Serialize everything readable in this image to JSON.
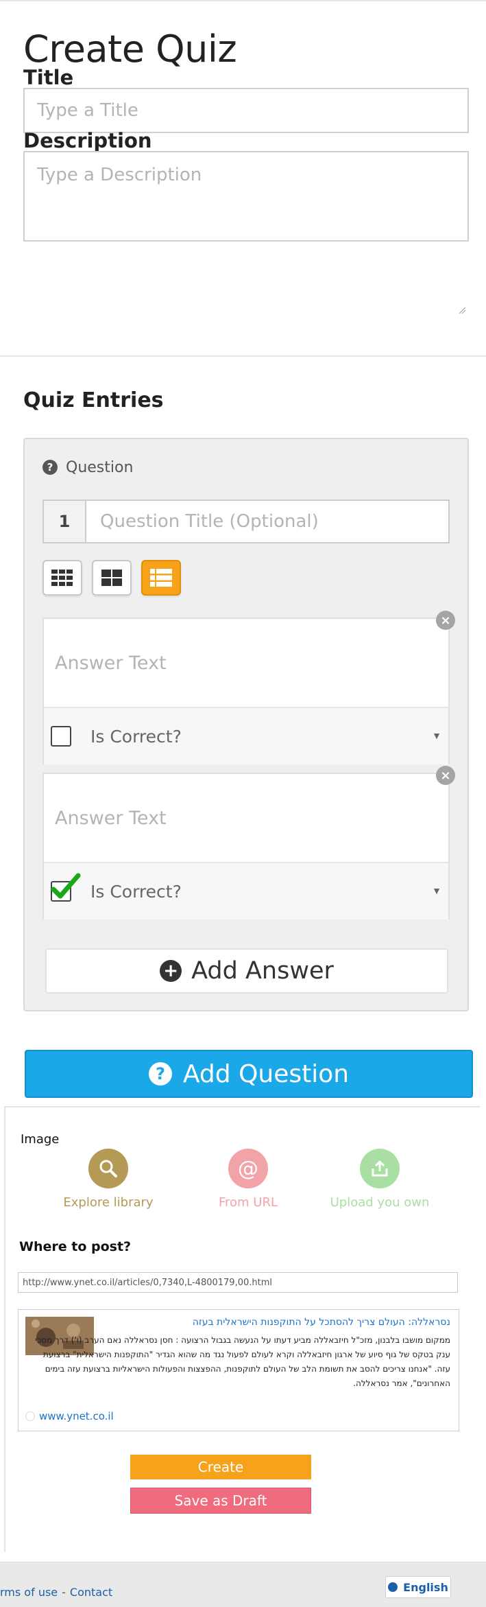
{
  "header": {
    "title": "Create Quiz"
  },
  "form": {
    "title_label": "Title",
    "title_placeholder": "Type a Title",
    "description_label": "Description",
    "description_placeholder": "Type a Description"
  },
  "entries": {
    "section_title": "Quiz Entries",
    "question_label": "Question",
    "question_number": "1",
    "question_placeholder": "Question Title (Optional)",
    "layout_options": [
      "grid-3x3-icon",
      "grid-2x2-icon",
      "list-icon"
    ],
    "active_layout": "list-icon",
    "answers": [
      {
        "placeholder": "Answer Text",
        "correct_label": "Is Correct?",
        "checked": false
      },
      {
        "placeholder": "Answer Text",
        "correct_label": "Is Correct?",
        "checked": true
      }
    ],
    "add_answer_label": "Add Answer",
    "add_question_label": "Add Question"
  },
  "image": {
    "label": "Image",
    "options": [
      {
        "label": "Explore library",
        "icon": "search-icon",
        "color": "#b59a55"
      },
      {
        "label": "From URL",
        "icon": "at-sign-icon",
        "color": "#f2a3a8"
      },
      {
        "label": "Upload you own",
        "icon": "upload-icon",
        "color": "#a9dfa2"
      }
    ]
  },
  "post": {
    "label": "Where to post?",
    "url": "http://www.ynet.co.il/articles/0,7340,L-4800179,00.html",
    "preview": {
      "title": "נסראללה: העולם צריך להסתכל על התוקפנות הישראלית בעזה",
      "body": "ממקום מושבו בלבנון, מזכ\"ל חיזבאללה מביע דעתו על הנעשה בגבול הרצועה : חסן נסראללה נאם הערב (ו') דרך מסכי ענק בטקס של גוף סיוע של ארגון חיזבאללה וקרא לעולם לפעול נגד מה שהוא הגדיר \"התוקפנות הישראלית\" ברצועת עזה. \"אנחנו צריכים להסב את תשומת הלב של העולם לתוקפנות, ההפצצות והפעולות הישראליות ברצועת עזה בימים האחרונים\", אמר נסראללה.",
      "domain": "www.ynet.co.il"
    }
  },
  "actions": {
    "create_label": "Create",
    "draft_label": "Save as Draft"
  },
  "footer": {
    "terms": "rms of use",
    "dash1": "-",
    "contact": "Contact",
    "language": "English"
  },
  "colors": {
    "accent_orange": "#f7a21b",
    "accent_blue": "#1ba8e8",
    "draft_pink": "#f06b7d",
    "link_blue": "#1a73c9"
  }
}
